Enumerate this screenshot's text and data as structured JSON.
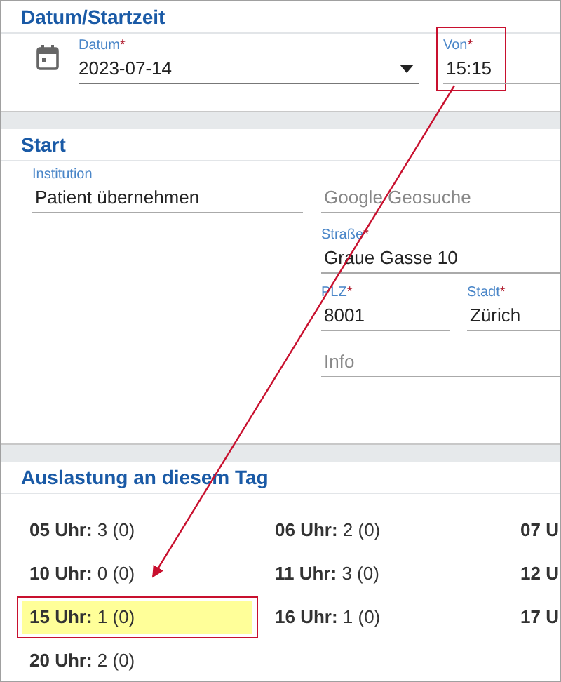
{
  "date_section": {
    "title": "Datum/Startzeit",
    "date": {
      "label": "Datum",
      "mark": "*",
      "value": "2023-07-14"
    },
    "time": {
      "label": "Von",
      "mark": "*",
      "value": "15:15",
      "annotated": true
    }
  },
  "start_section": {
    "title": "Start",
    "institution": {
      "label": "Institution",
      "value": "Patient übernehmen"
    },
    "geosearch": {
      "placeholder": "Google Geosuche"
    },
    "street": {
      "label": "Straße",
      "mark": "*",
      "value": "Graue Gasse 10"
    },
    "zip": {
      "label": "PLZ",
      "mark": "*",
      "value": "8001"
    },
    "city": {
      "label": "Stadt",
      "mark": "*",
      "value": "Zürich"
    },
    "info": {
      "placeholder": "Info"
    }
  },
  "load_section": {
    "title": "Auslastung an diesem Tag",
    "cells": [
      {
        "text": "**05 Uhr:** 3 (0)",
        "highlighted": false
      },
      {
        "text": "**06 Uhr:** 2 (0)",
        "highlighted": false
      },
      {
        "text": "**07 U**",
        "highlighted": false
      },
      {
        "text": "**10 Uhr:** 0 (0)",
        "highlighted": false
      },
      {
        "text": "**11 Uhr:** 3 (0)",
        "highlighted": false
      },
      {
        "text": "**12 U**",
        "highlighted": false
      },
      {
        "text": "**15 Uhr:** 1 (0)",
        "highlighted": true
      },
      {
        "text": "**16 Uhr:** 1 (0)",
        "highlighted": false
      },
      {
        "text": "**17 U**",
        "highlighted": false
      },
      {
        "text": "**20 Uhr:** 2 (0)",
        "highlighted": false
      }
    ]
  }
}
